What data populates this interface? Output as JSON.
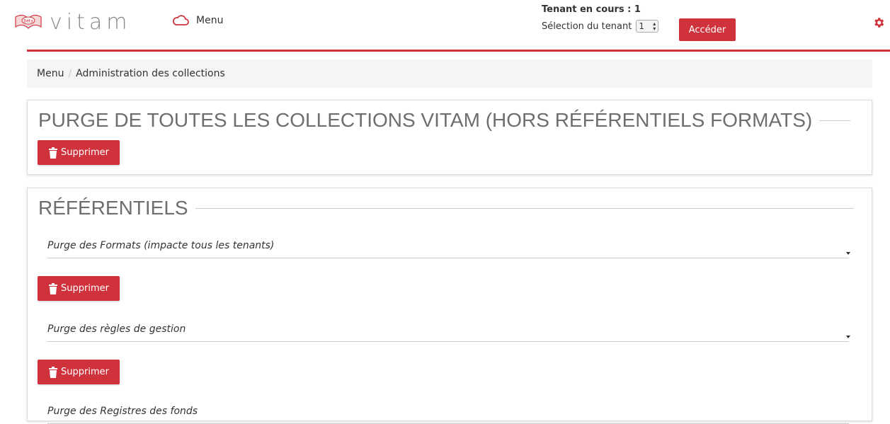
{
  "header": {
    "logo_text": "vitam",
    "menu_label": "Menu",
    "tenant_current": "Tenant en cours : 1",
    "tenant_selection_label": "Sélection du tenant",
    "tenant_selected_value": "1",
    "access_button": "Accéder"
  },
  "breadcrumb": {
    "items": [
      "Menu",
      "Administration des collections"
    ],
    "separator": "/"
  },
  "purge_all": {
    "title": "PURGE DE TOUTES LES COLLECTIONS VITAM (HORS RÉFÉRENTIELS FORMATS)",
    "delete_button": "Supprimer"
  },
  "referentiels": {
    "title": "RÉFÉRENTIELS",
    "sections": [
      {
        "label": "Purge des Formats (impacte tous les tenants)",
        "delete_button": "Supprimer"
      },
      {
        "label": "Purge des règles de gestion",
        "delete_button": "Supprimer"
      },
      {
        "label": "Purge des Registres des fonds"
      }
    ]
  },
  "colors": {
    "accent": "#d0323c",
    "title_gray": "#6e6e6e"
  },
  "icons": [
    "cloud-icon",
    "gear-icon",
    "trash-icon",
    "chevron-down-icon",
    "logo-book-icon"
  ]
}
